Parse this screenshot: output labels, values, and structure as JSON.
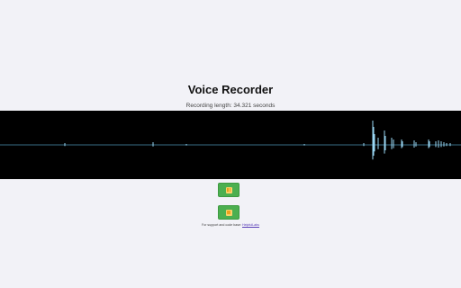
{
  "app": {
    "title": "Voice Recorder",
    "recording_length": "Recording length: 34.321 seconds"
  },
  "controls": {
    "pause_icon": "pause-icon",
    "stop_icon": "stop-icon",
    "button_color": "#4caf50"
  },
  "footer": {
    "text": "For support and code base: ",
    "link": "HelpfulLabs"
  },
  "waveform": {
    "background": "#000000",
    "color": "#9ad8f5"
  }
}
